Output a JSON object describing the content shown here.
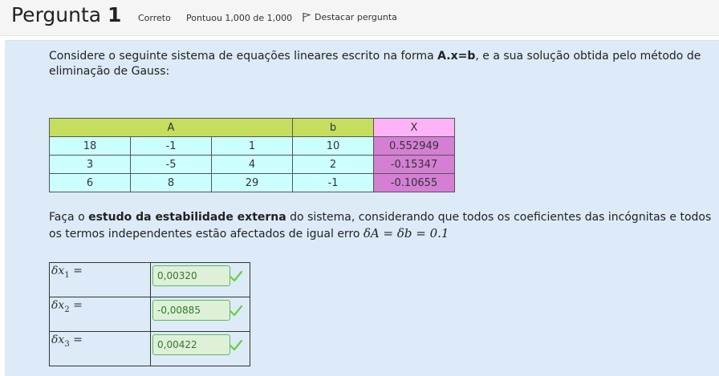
{
  "header": {
    "title_word": "Pergunta",
    "title_number": "1",
    "status": "Correto",
    "score": "Pontuou 1,000 de 1,000",
    "flag_label": "Destacar pergunta"
  },
  "question": {
    "intro_pre": "Considere o seguinte sistema de equações lineares escrito na forma ",
    "intro_bold": "A.x=b",
    "intro_post": ", e a sua solução obtida pelo método de eliminação de Gauss:",
    "table": {
      "headers": {
        "A": "A",
        "b": "b",
        "X": "X"
      },
      "rows": [
        {
          "a1": "18",
          "a2": "-1",
          "a3": "1",
          "b": "10",
          "x": "0.552949"
        },
        {
          "a1": "3",
          "a2": "-5",
          "a3": "4",
          "b": "2",
          "x": "-0.15347"
        },
        {
          "a1": "6",
          "a2": "8",
          "a3": "29",
          "b": "-1",
          "x": "-0.10655"
        }
      ]
    },
    "task_pre": "Faça o ",
    "task_bold": "estudo da estabilidade externa",
    "task_post": " do sistema, considerando que todos os coeficientes das incógnitas e todos os termos independentes estão afectados de igual erro ",
    "task_math": "δA = δb = 0.1"
  },
  "answers": [
    {
      "label_base": "δx",
      "label_sub": "1",
      "label_eq": " =",
      "value": "0,00320"
    },
    {
      "label_base": "δx",
      "label_sub": "2",
      "label_eq": " =",
      "value": "-0,00885"
    },
    {
      "label_base": "δx",
      "label_sub": "3",
      "label_eq": " =",
      "value": "0,00422"
    }
  ],
  "colors": {
    "header_bg": "#f5f5f5",
    "content_bg": "#dcebf7",
    "table_header_green": "#c5de5e",
    "table_header_pink": "#ffb3f7",
    "table_cell_cyan": "#ccffff",
    "table_x_purple": "#d47fd4",
    "correct_green": "#5cb85c"
  },
  "icons": {
    "flag": "flag-icon",
    "check": "check-icon"
  }
}
